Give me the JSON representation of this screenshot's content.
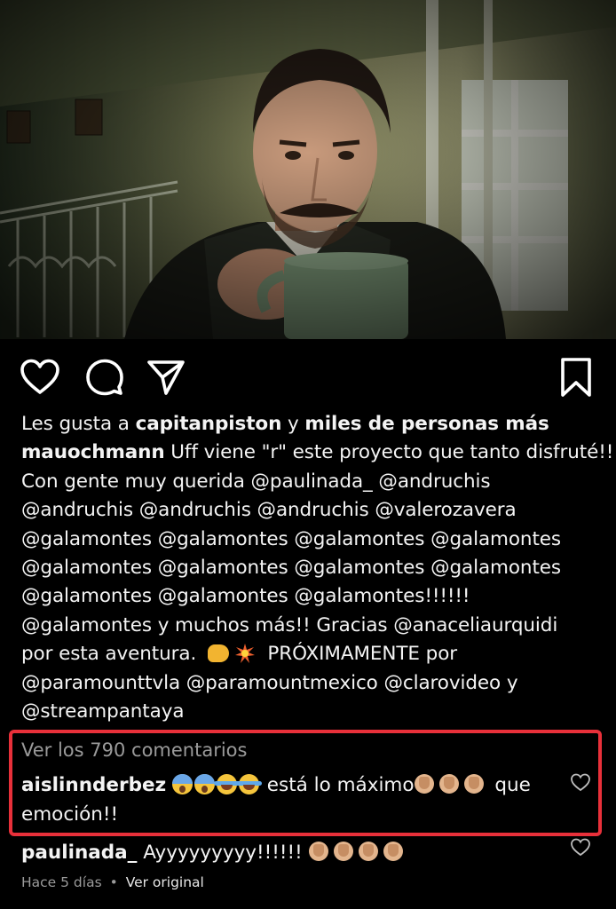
{
  "post": {
    "likes_prefix": "Les gusta a",
    "likes_user": "capitanpiston",
    "likes_conj": "y",
    "likes_rest": "miles de personas más",
    "author": "mauochmann",
    "caption_lines": [
      "Uff viene \"r\" este proyecto que tanto disfruté!!",
      "Con gente muy querida @paulinada_ @andruchis",
      "@andruchis @andruchis @andruchis @valerozavera",
      "@galamontes @galamontes @galamontes @galamontes",
      "@galamontes @galamontes @galamontes @galamontes",
      "@galamontes @galamontes @galamontes!!!!!!",
      "@galamontes y muchos más!! Gracias @anaceliaurquidi",
      "por esta aventura.",
      "PRÓXIMAMENTE por",
      "@paramounttvla @paramountmexico @clarovideo y",
      "@streampantaya"
    ]
  },
  "comments": {
    "view_all": "Ver los 790 comentarios",
    "items": [
      {
        "user": "aislinnderbez",
        "text_a": "está lo máximo",
        "text_b": "que",
        "text_c": "emoción!!"
      },
      {
        "user": "paulinada_",
        "text": "Ayyyyyyyyy!!!!!!"
      }
    ]
  },
  "meta": {
    "time": "Hace 5 días",
    "dot": "•",
    "translate": "Ver original"
  },
  "colors": {
    "highlight_border": "#e8303a",
    "secondary_text": "#9a9a9a"
  },
  "icons": {
    "like": "heart-icon",
    "comment": "comment-bubble-icon",
    "share": "paper-plane-icon",
    "save": "bookmark-icon"
  }
}
